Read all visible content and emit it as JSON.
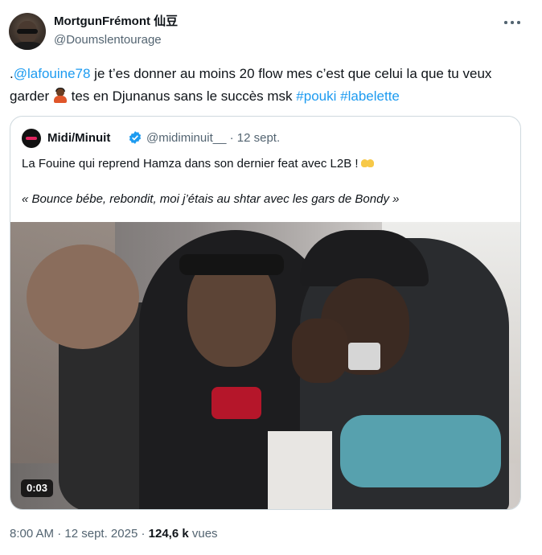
{
  "author": {
    "name": "MortgunFrémont 仙豆",
    "handle": "@Doumslentourage"
  },
  "tweet": {
    "prefix": ".",
    "mention": "@lafouine78",
    "text_part1": " je t’es donner au moins 20 flow mes c’est que celui la que tu veux garder ",
    "text_part2": " tes en Djunanus sans le succès msk ",
    "hashtag1": "#pouki",
    "hashtag2": "#labelette"
  },
  "quoted": {
    "name": "Midi/Minuit",
    "handle": "@midiminuit__",
    "date": "· 12 sept.",
    "line1": "La Fouine qui reprend Hamza dans son dernier feat avec L2B !",
    "line2": "« Bounce bébe, rebondit, moi j’étais au shtar avec les gars de Bondy »",
    "video_duration": "0:03"
  },
  "meta": {
    "time": "8:00 AM",
    "sep1": " · ",
    "date": "12 sept. 2025",
    "sep2": " · ",
    "views_count": "124,6 k",
    "views_label": " vues"
  },
  "colors": {
    "link": "#1d9bf0",
    "secondary_text": "#536471",
    "border": "#cfd9de"
  }
}
